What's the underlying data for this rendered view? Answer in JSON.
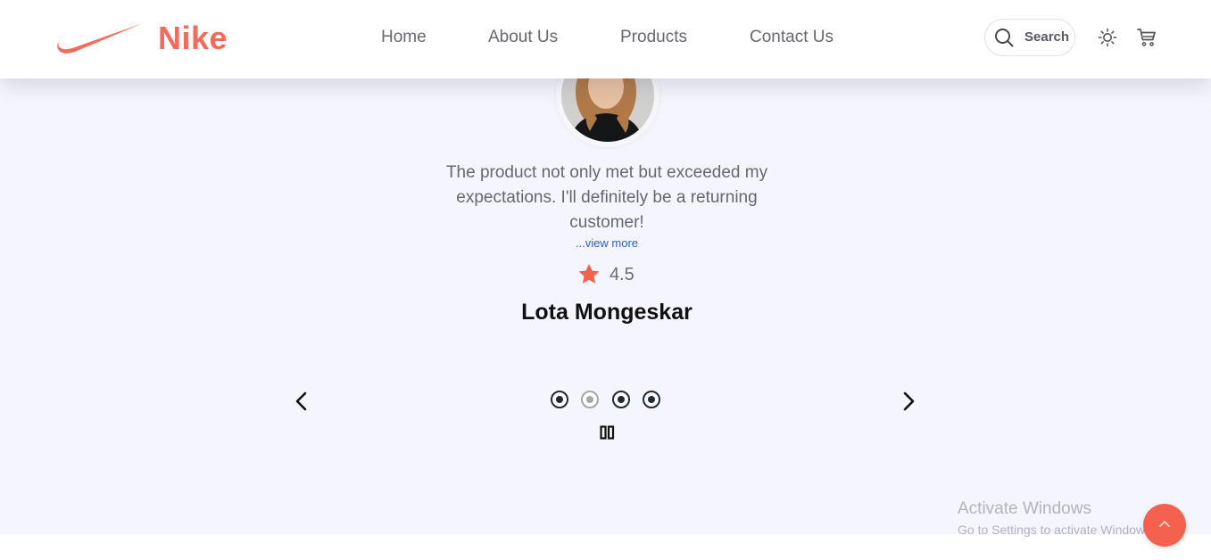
{
  "brand": {
    "name": "Nike",
    "logo_icon": "swoosh-icon",
    "accent_color": "#f26b5b"
  },
  "nav": {
    "links": [
      "Home",
      "About Us",
      "Products",
      "Contact Us"
    ]
  },
  "header_actions": {
    "search_label": "Search",
    "search_icon": "search-icon",
    "theme_icon": "sun-icon",
    "cart_icon": "cart-icon"
  },
  "testimonial": {
    "quote": "The product not only met but exceeded my expectations. I'll definitely be a returning customer!",
    "view_more": "...view more",
    "rating": "4.5",
    "rating_icon": "star-icon",
    "name": "Lota Mongeskar"
  },
  "carousel": {
    "prev_icon": "chevron-left-icon",
    "next_icon": "chevron-right-icon",
    "slide_count": 4,
    "active_index": 1,
    "pause_icon": "pause-icon"
  },
  "watermark": {
    "title": "Activate Windows",
    "subtitle": "Go to Settings to activate Windows."
  },
  "scroll_top_icon": "chevron-up-icon"
}
